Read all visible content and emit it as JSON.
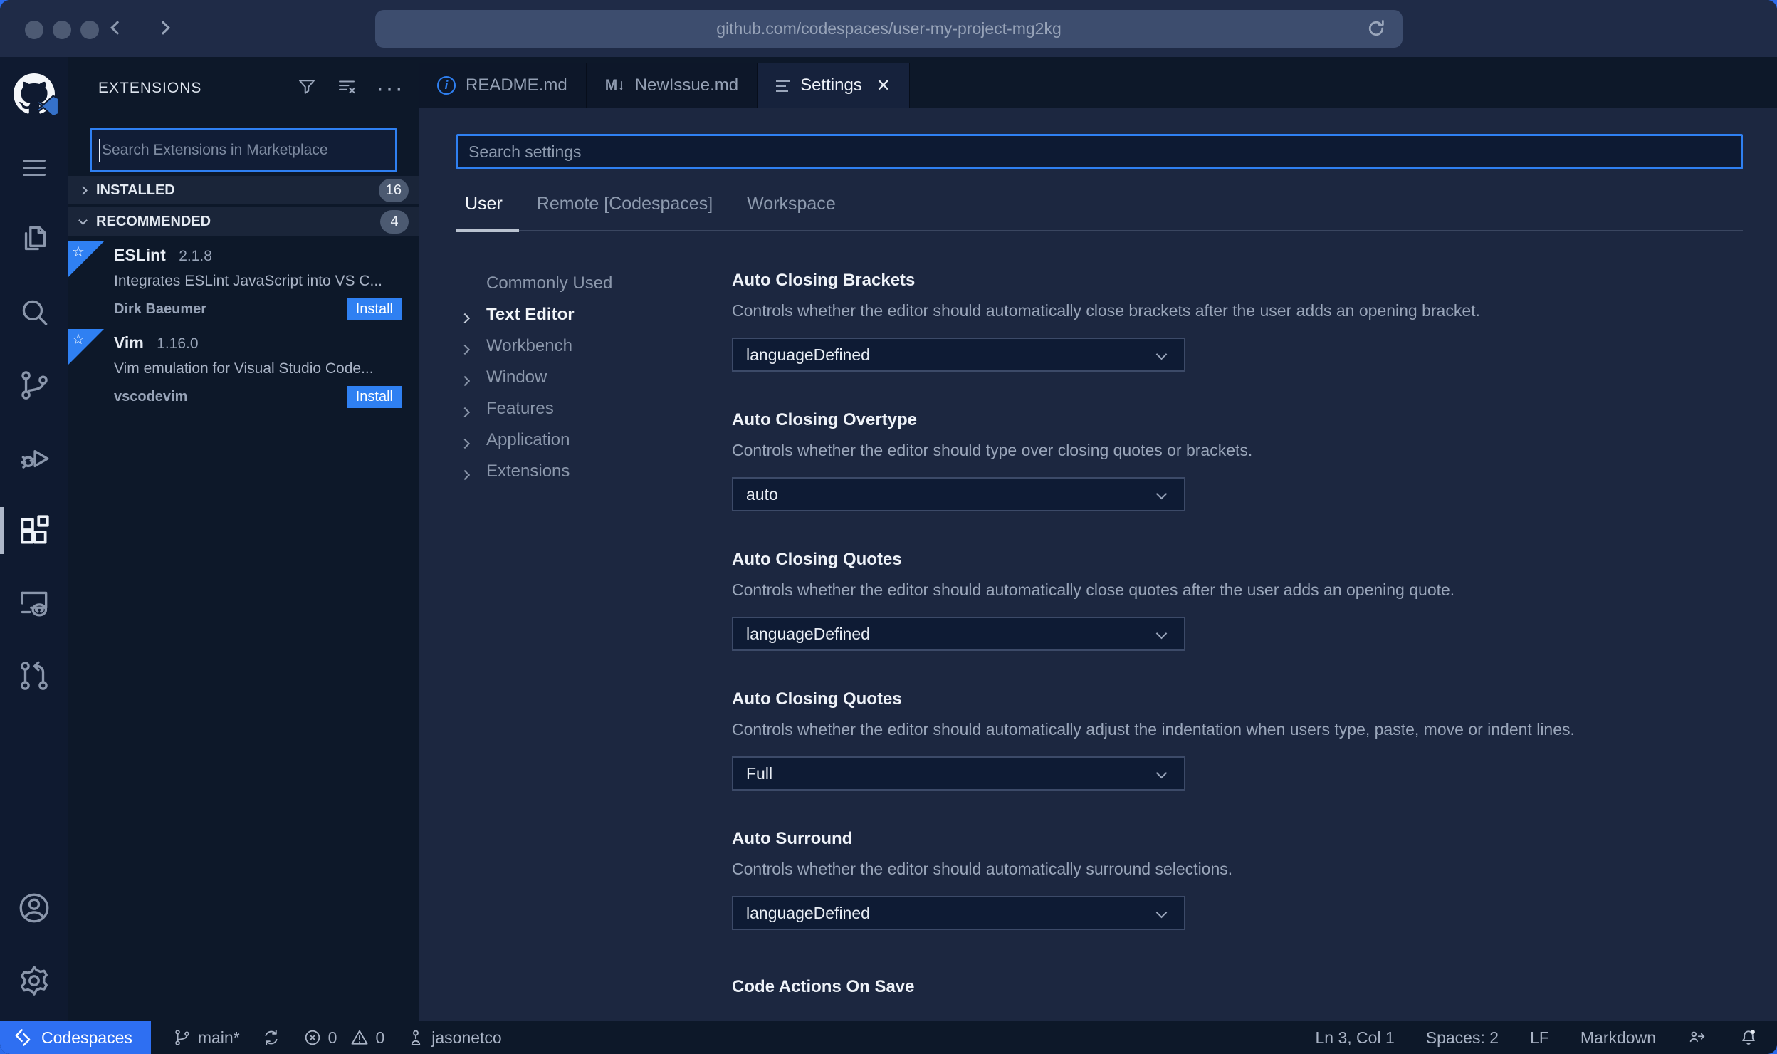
{
  "browser": {
    "url": "github.com/codespaces/user-my-project-mg2kg"
  },
  "activity_bar": {
    "items": [
      "explorer",
      "search",
      "source-control",
      "run-and-debug",
      "extensions",
      "remote-explorer",
      "pull-requests",
      "account",
      "settings-gear"
    ]
  },
  "sidebar": {
    "title": "EXTENSIONS",
    "search_placeholder": "Search Extensions in Marketplace",
    "sections": [
      {
        "label": "INSTALLED",
        "count": "16"
      },
      {
        "label": "RECOMMENDED",
        "count": "4"
      }
    ],
    "extensions": [
      {
        "name": "ESLint",
        "version": "2.1.8",
        "description": "Integrates ESLint JavaScript into VS C...",
        "author": "Dirk Baeumer",
        "action": "Install"
      },
      {
        "name": "Vim",
        "version": "1.16.0",
        "description": "Vim emulation for Visual Studio Code...",
        "author": "vscodevim",
        "action": "Install"
      }
    ]
  },
  "editor": {
    "tabs": [
      {
        "label": "README.md"
      },
      {
        "label": "NewIssue.md"
      },
      {
        "label": "Settings"
      }
    ]
  },
  "settings": {
    "search_placeholder": "Search settings",
    "scope_tabs": [
      "User",
      "Remote [Codespaces]",
      "Workspace"
    ],
    "tree": [
      "Commonly Used",
      "Text Editor",
      "Workbench",
      "Window",
      "Features",
      "Application",
      "Extensions"
    ],
    "items": [
      {
        "title": "Auto Closing Brackets",
        "description": "Controls whether the editor should automatically close brackets after the user adds an opening bracket.",
        "value": "languageDefined"
      },
      {
        "title": "Auto Closing Overtype",
        "description": "Controls whether the editor should type over closing quotes or brackets.",
        "value": "auto"
      },
      {
        "title": "Auto Closing Quotes",
        "description": "Controls whether the editor should automatically close quotes after the user adds an opening quote.",
        "value": "languageDefined"
      },
      {
        "title": "Auto Closing Quotes",
        "description": "Controls whether the editor should automatically adjust the indentation when users type, paste, move or indent lines.",
        "value": "Full"
      },
      {
        "title": "Auto Surround",
        "description": "Controls whether the editor should automatically surround selections.",
        "value": "languageDefined"
      },
      {
        "title": "Code Actions On Save",
        "description": "",
        "value": ""
      }
    ]
  },
  "status_bar": {
    "codespaces_label": "Codespaces",
    "branch": "main*",
    "errors": "0",
    "warnings": "0",
    "user": "jasonetco",
    "line_col": "Ln 3, Col 1",
    "indent": "Spaces: 2",
    "eol": "LF",
    "language": "Markdown"
  },
  "colors": {
    "accent_blue": "#2f80f2",
    "codespaces_blue": "#2e6ff2",
    "editor_bg": "#1c2740",
    "shell_bg": "#0d1829",
    "chrome_bg": "#1f2b47"
  }
}
